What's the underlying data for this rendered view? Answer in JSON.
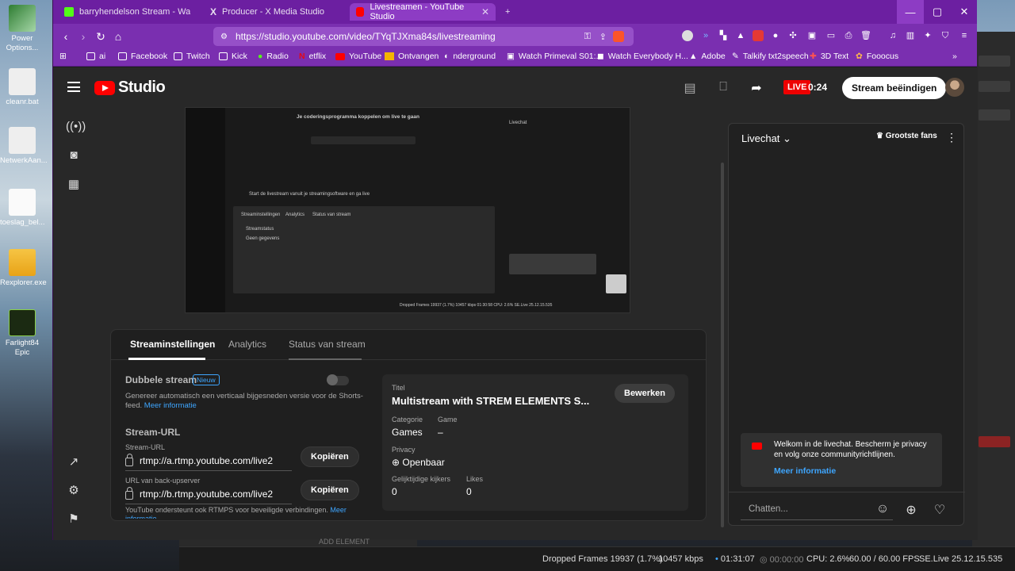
{
  "desktop": {
    "icons": [
      {
        "label": "Power Options..."
      },
      {
        "label": "cleanr.bat"
      },
      {
        "label": "NetwerkAan..."
      },
      {
        "label": "toeslag_bel..."
      },
      {
        "label": "Rexplorer.exe"
      },
      {
        "label": "Farlight84 Epic"
      }
    ]
  },
  "browser": {
    "tabs": [
      {
        "label": "barryhendelson Stream - Watch Live",
        "favicon_color": "#53fc18"
      },
      {
        "label": "Producer - X Media Studio",
        "favicon_color": "#ffffff"
      },
      {
        "label": "Livestreamen - YouTube Studio",
        "favicon_color": "#ff0000"
      }
    ],
    "new_tab": "+",
    "url": "https://studio.youtube.com/video/TYqTJXma84s/livestreaming",
    "bookmarks": [
      "ai",
      "Facebook",
      "Twitch",
      "Kick",
      "Radio",
      "etflix",
      "YouTube",
      "Ontvangen",
      "nderground",
      "Watch Primeval S01:...",
      "Watch Everybody H...",
      "Adobe",
      "Talkify txt2speech",
      "3D Text",
      "Fooocus"
    ],
    "accent": "#7a2fb0"
  },
  "studio": {
    "logo_text": "Studio",
    "live_badge": "LIVE",
    "live_time": "0:24",
    "end_stream": "Stream beëindigen",
    "preview": {
      "heading": "Je coderingsprogramma koppelen om live te gaan",
      "step": "Start de livestream vanuit je streamingsoftware en ga live",
      "tabs": [
        "Streaminstellingen",
        "Analytics",
        "Status van stream"
      ],
      "status_label": "Streamstatus",
      "status_value": "Geen gegevens",
      "chat_label": "Livechat",
      "status_strip": "Dropped Frames 19937 (1.7%)  10457 kbps  01:30:58  CPU: 2.6%  SE.Live 25.12.15.535"
    },
    "settings": {
      "tabs": [
        "Streaminstellingen",
        "Analytics",
        "Status van stream"
      ],
      "dual_stream": {
        "title": "Dubbele stream",
        "badge": "Nieuw",
        "desc": "Genereer automatisch een verticaal bijgesneden versie voor de Shorts-feed.",
        "link": "Meer informatie"
      },
      "stream_url_section": "Stream-URL",
      "stream_url_label": "Stream-URL",
      "stream_url": "rtmp://a.rtmp.youtube.com/live2",
      "backup_label": "URL van back-upserver",
      "backup_url": "rtmp://b.rtmp.youtube.com/live2",
      "copy": "Kopiëren",
      "rtmps_note": "YouTube ondersteunt ook RTMPS voor beveiligde verbindingen.",
      "rtmps_link": "Meer informatie"
    },
    "info": {
      "title_label": "Titel",
      "title": "Multistream with STREM ELEMENTS S...",
      "edit": "Bewerken",
      "category_label": "Categorie",
      "category": "Games",
      "game_label": "Game",
      "game": "–",
      "privacy_label": "Privacy",
      "privacy": "Openbaar",
      "viewers_label": "Gelijktijdige kijkers",
      "viewers": "0",
      "likes_label": "Likes",
      "likes": "0"
    },
    "chat": {
      "title": "Livechat",
      "top_fans": "Grootste fans",
      "welcome": "Welkom in de livechat. Bescherm je privacy en volg onze communityrichtlijnen.",
      "welcome_link": "Meer informatie",
      "placeholder": "Chatten..."
    }
  },
  "statusbar": {
    "dropped": "Dropped Frames 19937 (1.7%)",
    "kbps": "10457 kbps",
    "time1": "01:31:07",
    "time2": "00:00:00",
    "cpu": "CPU: 2.6%",
    "fps": "60.00 / 60.00 FPS",
    "version": "SE.Live 25.12.15.535"
  },
  "obs_add_element": "ADD ELEMENT"
}
